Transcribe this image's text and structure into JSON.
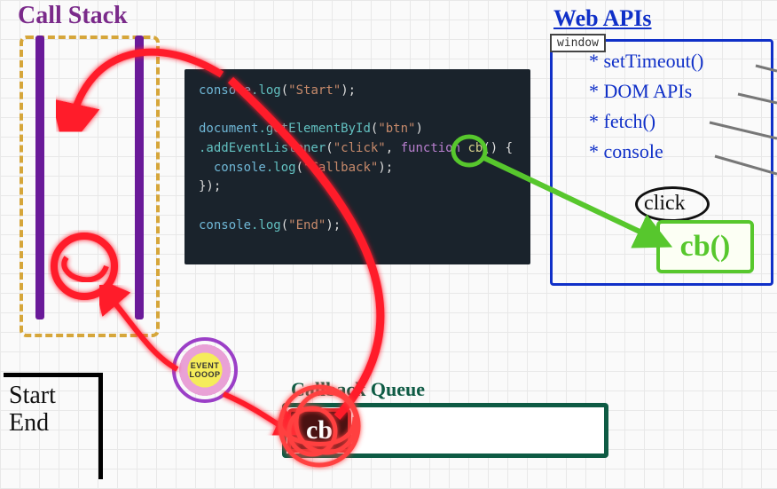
{
  "callstack": {
    "label": "Call Stack"
  },
  "output": {
    "lines": [
      "Start",
      "End"
    ]
  },
  "code": {
    "l1a": "console",
    "l1b": ".log",
    "l1c": "(",
    "l1d": "\"Start\"",
    "l1e": ");",
    "l2a": "document",
    "l2b": ".getElementById",
    "l2c": "(",
    "l2d": "\"btn\"",
    "l2e": ")",
    "l3a": ".addEventListener",
    "l3b": "(",
    "l3c": "\"click\"",
    "l3d": ", ",
    "l3e": "function",
    "l3f": " ",
    "l3g": "cb",
    "l3h": "() {",
    "l4a": "  console",
    "l4b": ".log",
    "l4c": "(",
    "l4d": "\"Callback\"",
    "l4e": ");",
    "l5a": "});",
    "l6a": "console",
    "l6b": ".log",
    "l6c": "(",
    "l6d": "\"End\"",
    "l6e": ");"
  },
  "webapis": {
    "title": "Web APIs",
    "window_tag": "window",
    "items": [
      "setTimeout()",
      "DOM APIs",
      "fetch()",
      "console"
    ],
    "event_label": "click",
    "callback_label": "cb()"
  },
  "event_loop": {
    "label": "EVENT LOOOP"
  },
  "queue": {
    "label": "Callback Queue",
    "item_label": "cb"
  },
  "colors": {
    "callstack": "#6a1a99",
    "webapis": "#1030c8",
    "green": "#57c72d",
    "queue": "#0e5b44",
    "red": "#ff1a2a"
  }
}
